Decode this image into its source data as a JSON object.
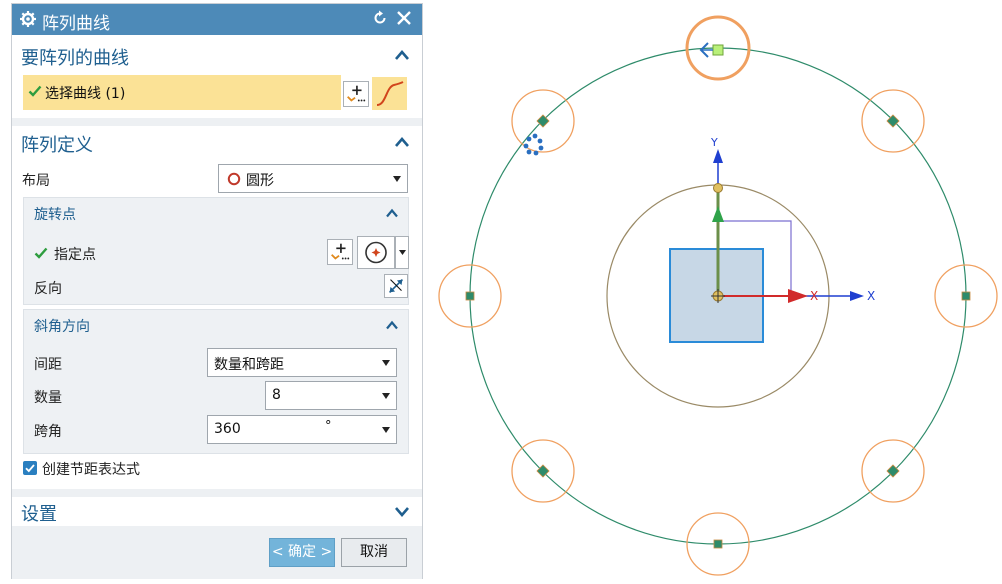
{
  "dialog": {
    "title": "阵列曲线",
    "reset_icon": "reset-icon",
    "close_icon": "close-icon"
  },
  "curves_section": {
    "title": "要阵列的曲线",
    "select_label": "选择曲线 (1)"
  },
  "array_def": {
    "title": "阵列定义",
    "layout_label": "布局",
    "layout_value": "圆形",
    "rotation_point": {
      "title": "旋转点",
      "specify_point_label": "指定点",
      "reverse_label": "反向"
    },
    "angle_direction": {
      "title": "斜角方向",
      "spacing_label": "间距",
      "spacing_value": "数量和跨距",
      "count_label": "数量",
      "count_value": "8",
      "span_label": "跨角",
      "span_value": "360",
      "span_unit": "°"
    },
    "create_expression_label": "创建节距表达式",
    "create_expression_checked": true
  },
  "settings_section": {
    "title": "设置"
  },
  "buttons": {
    "ok_label": "< 确定 >",
    "cancel_label": "取消"
  },
  "viewport": {
    "axis_x_label": "X",
    "axis_y_label": "Y",
    "axis_x2_label": "X"
  },
  "colors": {
    "title_bar": "#4d8ab8",
    "section_title": "#1f5f8f",
    "selection_highlight": "#fbe296",
    "ok_button": "#73b4da",
    "circle_green": "#2e8b6a",
    "circle_orange": "#f0a060"
  }
}
